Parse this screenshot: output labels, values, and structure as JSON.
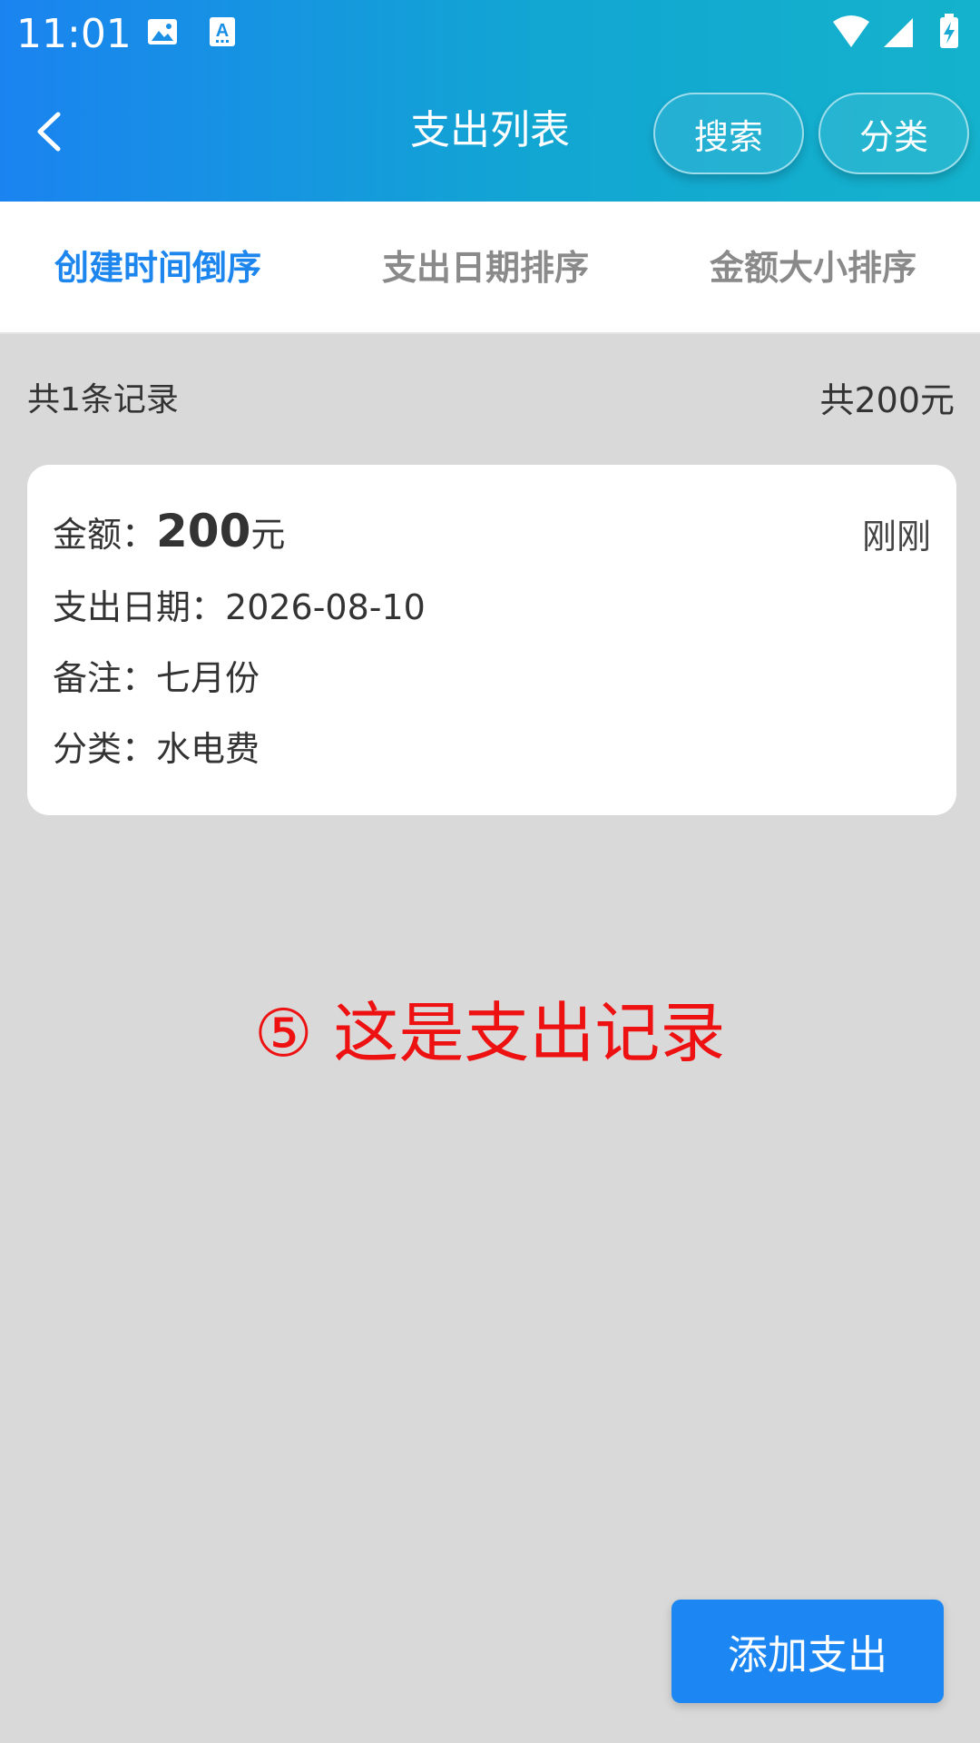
{
  "status_bar": {
    "time": "11:01",
    "icons": [
      "image-icon",
      "text-a-icon",
      "wifi-icon",
      "signal-icon",
      "battery-charging-icon"
    ]
  },
  "header": {
    "title": "支出列表",
    "search_label": "搜索",
    "category_label": "分类",
    "back_icon": "chevron-left-icon"
  },
  "tabs": [
    {
      "label": "创建时间倒序",
      "active": true
    },
    {
      "label": "支出日期排序",
      "active": false
    },
    {
      "label": "金额大小排序",
      "active": false
    }
  ],
  "summary": {
    "count_text": "共1条记录",
    "total_text": "共200元"
  },
  "records": [
    {
      "amount_label": "金额：",
      "amount_value": "200",
      "amount_unit": "元",
      "time_ago": "刚刚",
      "date_label": "支出日期：",
      "date_value": "2026-08-10",
      "note_label": "备注：",
      "note_value": "七月份",
      "category_label": "分类：",
      "category_value": "水电费"
    }
  ],
  "annotation": "⑤ 这是支出记录",
  "add_button_label": "添加支出",
  "colors": {
    "header_gradient_start": "#1a83f0",
    "header_gradient_end": "#14b2cc",
    "accent": "#1c86ee",
    "annotation": "#ee1111",
    "background": "#d9d9d9"
  }
}
